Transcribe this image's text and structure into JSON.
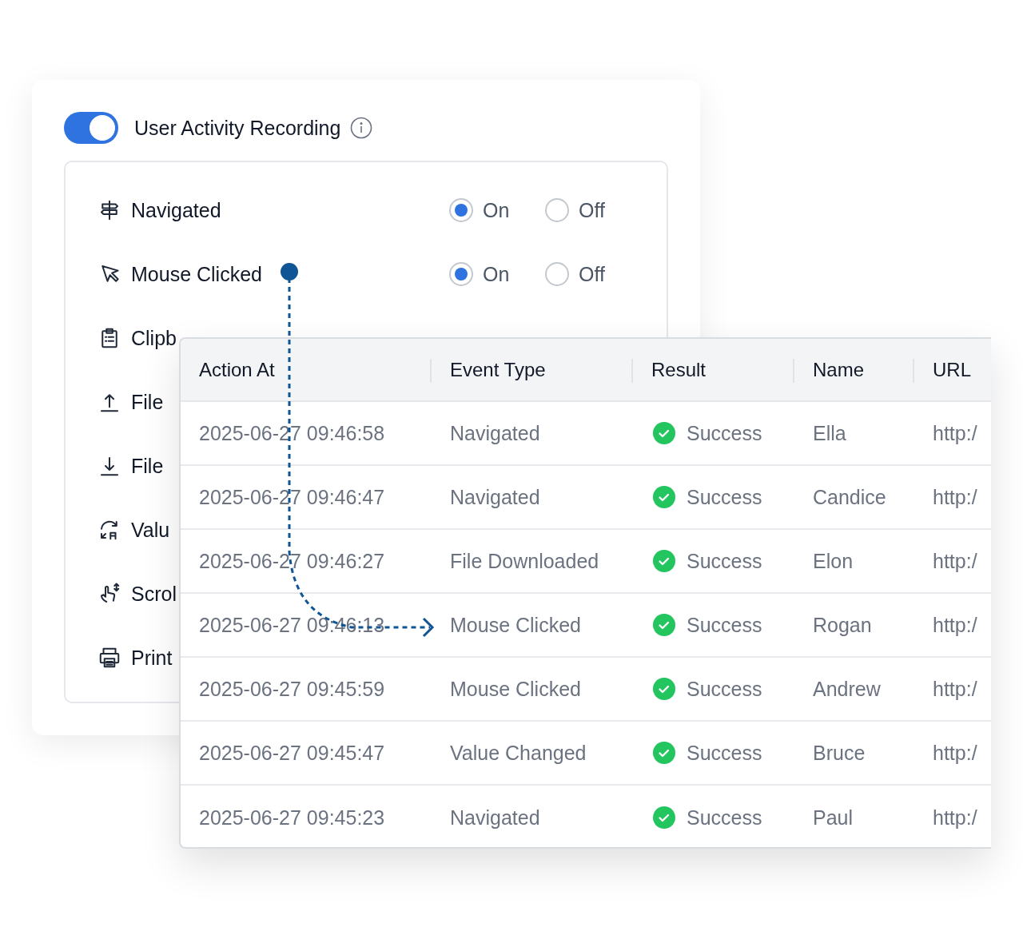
{
  "recording": {
    "on": true,
    "title": "User Activity Recording"
  },
  "events": [
    {
      "label": "Navigated",
      "options": [
        {
          "label": "On",
          "selected": true
        },
        {
          "label": "Off",
          "selected": false
        }
      ]
    },
    {
      "label": "Mouse Clicked",
      "options": [
        {
          "label": "On",
          "selected": true
        },
        {
          "label": "Off",
          "selected": false
        }
      ]
    },
    {
      "label": "Clipb"
    },
    {
      "label": "File"
    },
    {
      "label": "File"
    },
    {
      "label": "Valu"
    },
    {
      "label": "Scrol"
    },
    {
      "label": "Print"
    }
  ],
  "table": {
    "columns": [
      "Action At",
      "Event Type",
      "Result",
      "Name",
      "URL"
    ],
    "rows": [
      [
        "2025-06-27 09:46:58",
        "Navigated",
        "Success",
        "Ella",
        "http:/"
      ],
      [
        "2025-06-27 09:46:47",
        "Navigated",
        "Success",
        "Candice",
        "http:/"
      ],
      [
        "2025-06-27 09:46:27",
        "File Downloaded",
        "Success",
        "Elon",
        "http:/"
      ],
      [
        "2025-06-27 09:46:13",
        "Mouse Clicked",
        "Success",
        "Rogan",
        "http:/"
      ],
      [
        "2025-06-27 09:45:59",
        "Mouse Clicked",
        "Success",
        "Andrew",
        "http:/"
      ],
      [
        "2025-06-27 09:45:47",
        "Value Changed",
        "Success",
        "Bruce",
        "http:/"
      ],
      [
        "2025-06-27 09:45:23",
        "Navigated",
        "Success",
        "Paul",
        "http:/"
      ]
    ]
  }
}
